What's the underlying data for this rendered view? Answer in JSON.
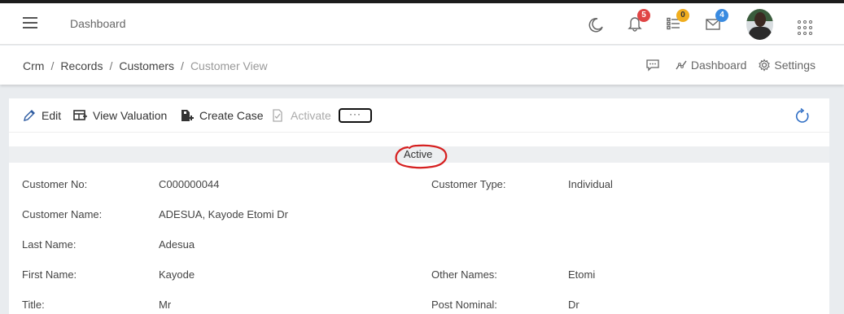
{
  "header": {
    "title": "Dashboard",
    "notifications_count": "5",
    "tasks_count": "0",
    "messages_count": "4",
    "colors": {
      "red": "#e04545",
      "yellow": "#f0ad1e",
      "blue": "#3a8be0"
    }
  },
  "breadcrumb": {
    "items": [
      "Crm",
      "Records",
      "Customers"
    ],
    "current": "Customer View",
    "separator": "/"
  },
  "top_links": {
    "dashboard": "Dashboard",
    "settings": "Settings"
  },
  "toolbar": {
    "edit": "Edit",
    "view_valuation": "View Valuation",
    "create_case": "Create Case",
    "activate": "Activate",
    "more": "···"
  },
  "status": "Active",
  "fields": {
    "customer_no_label": "Customer No:",
    "customer_no": "C000000044",
    "customer_type_label": "Customer Type:",
    "customer_type": "Individual",
    "customer_name_label": "Customer Name:",
    "customer_name": "ADESUA, Kayode Etomi Dr",
    "last_name_label": "Last Name:",
    "last_name": "Adesua",
    "first_name_label": "First Name:",
    "first_name": "Kayode",
    "other_names_label": "Other Names:",
    "other_names": "Etomi",
    "title_label": "Title:",
    "title": "Mr",
    "post_nominal_label": "Post Nominal:",
    "post_nominal": "Dr"
  }
}
